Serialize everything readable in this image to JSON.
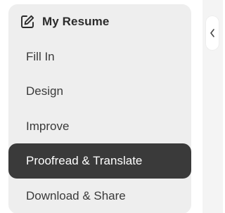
{
  "sidebar": {
    "title": "My Resume",
    "title_icon": "edit-icon",
    "items": [
      {
        "label": "Fill In",
        "active": false
      },
      {
        "label": "Design",
        "active": false
      },
      {
        "label": "Improve",
        "active": false
      },
      {
        "label": "Proofread & Translate",
        "active": true
      },
      {
        "label": "Download & Share",
        "active": false
      }
    ]
  },
  "panel": {
    "collapse_icon": "chevron-left-icon"
  },
  "colors": {
    "card_bg": "#eeeeee",
    "active_bg": "#3a3a3a",
    "active_text": "#ffffff",
    "text": "#3a3a3a"
  }
}
